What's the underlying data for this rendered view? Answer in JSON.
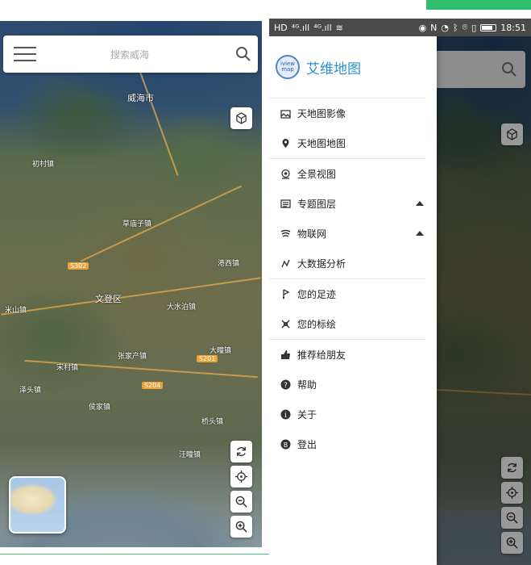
{
  "status_bar": {
    "left_icons": [
      "HD",
      "⁴ᴳ.ıll",
      "⁴ᴳ.ıll",
      "wifi"
    ],
    "right_icons": [
      "eye",
      "nfc",
      "alarm",
      "bluetooth",
      "location",
      "vibrate",
      "battery"
    ],
    "time": "18:51"
  },
  "left_screen": {
    "search": {
      "placeholder": "搜索威海"
    },
    "map_labels": [
      {
        "text": "威海市",
        "cls": "big"
      },
      {
        "text": "初村镇",
        "cls": ""
      },
      {
        "text": "草庙子镇",
        "cls": ""
      },
      {
        "text": "文登区",
        "cls": "big"
      },
      {
        "text": "大水泊镇",
        "cls": ""
      },
      {
        "text": "米山镇",
        "cls": ""
      },
      {
        "text": "泽头镇",
        "cls": ""
      },
      {
        "text": "张家产镇",
        "cls": ""
      },
      {
        "text": "侯家镇",
        "cls": ""
      },
      {
        "text": "宋村镇",
        "cls": ""
      },
      {
        "text": "港西镇",
        "cls": ""
      },
      {
        "text": "桥头镇",
        "cls": ""
      },
      {
        "text": "大疃镇",
        "cls": ""
      },
      {
        "text": "汪疃镇",
        "cls": ""
      }
    ],
    "road_badges": [
      "S201",
      "S204",
      "S302"
    ]
  },
  "drawer": {
    "logo_text_1": "iview",
    "logo_text_2": "map",
    "title": "艾维地图",
    "groups": [
      [
        {
          "label": "天地图影像",
          "icon": "image-map-icon",
          "caret": false
        },
        {
          "label": "天地图地图",
          "icon": "map-pin-icon",
          "caret": false
        }
      ],
      [
        {
          "label": "全景视图",
          "icon": "panorama-icon",
          "caret": false
        },
        {
          "label": "专题图层",
          "icon": "layers-icon",
          "caret": true
        },
        {
          "label": "物联网",
          "icon": "iot-icon",
          "caret": true
        },
        {
          "label": "大数据分析",
          "icon": "analysis-icon",
          "caret": false
        }
      ],
      [
        {
          "label": "您的足迹",
          "icon": "footprint-icon",
          "caret": false
        },
        {
          "label": "您的标绘",
          "icon": "draw-icon",
          "caret": false
        }
      ],
      [
        {
          "label": "推荐给朋友",
          "icon": "thumbs-up-icon",
          "caret": false
        },
        {
          "label": "帮助",
          "icon": "help-icon",
          "caret": false
        },
        {
          "label": "关于",
          "icon": "info-icon",
          "caret": false
        },
        {
          "label": "登出",
          "icon": "logout-icon",
          "caret": false
        }
      ]
    ]
  }
}
